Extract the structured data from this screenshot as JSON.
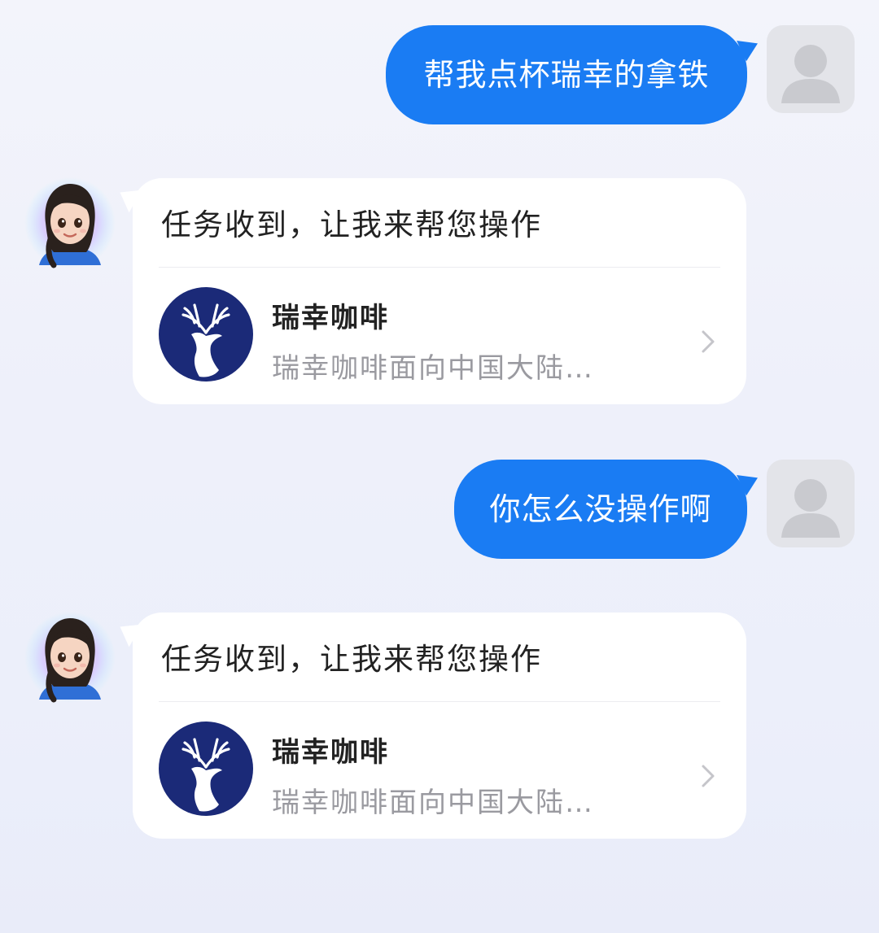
{
  "messages": [
    {
      "role": "user",
      "text": "帮我点杯瑞幸的拿铁"
    },
    {
      "role": "assistant",
      "text": "任务收到，让我来帮您操作",
      "card": {
        "title": "瑞幸咖啡",
        "description": "瑞幸咖啡面向中国大陆…",
        "logo_icon": "luckin-deer-logo",
        "logo_color": "#1b2a78"
      }
    },
    {
      "role": "user",
      "text": "你怎么没操作啊"
    },
    {
      "role": "assistant",
      "text": "任务收到，让我来帮您操作",
      "card": {
        "title": "瑞幸咖啡",
        "description": "瑞幸咖啡面向中国大陆…",
        "logo_icon": "luckin-deer-logo",
        "logo_color": "#1b2a78"
      }
    }
  ],
  "colors": {
    "user_bubble": "#1a7cf3",
    "assistant_bubble": "#ffffff",
    "background": "#eef0fa"
  },
  "icons": {
    "user_avatar": "user-silhouette-icon",
    "assistant_avatar": "assistant-girl-avatar",
    "card_arrow": "chevron-right-icon"
  }
}
